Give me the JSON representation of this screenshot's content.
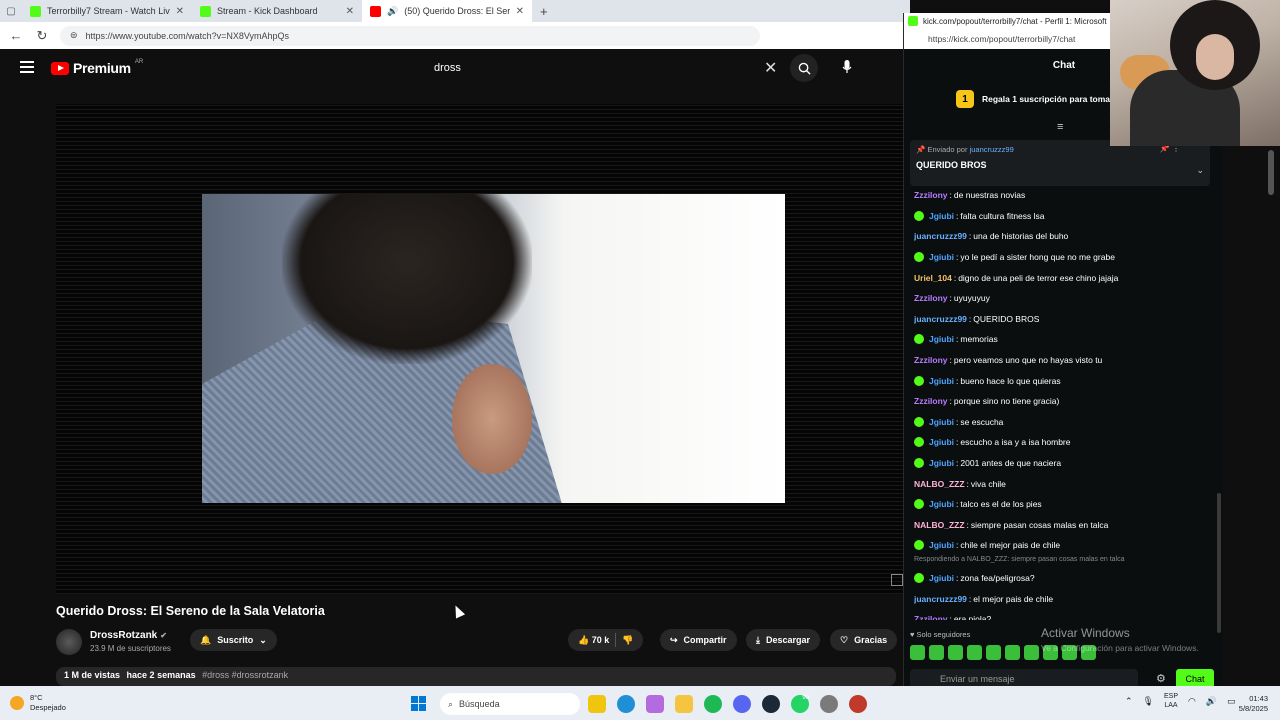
{
  "browser": {
    "tabs": [
      {
        "title": "Terrorbilly7 Stream - Watch Live o",
        "color": "#53fc18"
      },
      {
        "title": "Stream - Kick Dashboard",
        "color": "#53fc18"
      },
      {
        "title": "(50) Querido Dross: El Sereno",
        "color": "#ff0000"
      }
    ],
    "url": "https://www.youtube.com/watch?v=NX8VymAhpQs"
  },
  "youtube": {
    "logo": "Premium",
    "country": "AR",
    "search_value": "dross",
    "video_title": "Querido Dross: El Sereno de la Sala Velatoria",
    "channel_name": "DrossRotzank",
    "verified_mark": "✔",
    "subscribers": "23.9 M de suscriptores",
    "subscribed_label": "Suscrito",
    "likes": "70 k",
    "share_label": "Compartir",
    "download_label": "Descargar",
    "thanks_label": "Gracias",
    "views": "1 M de vistas",
    "age": "hace 2 semanas",
    "tags": "#dross #drossrotzank"
  },
  "kick": {
    "window_title": "kick.com/popout/terrorbilly7/chat - Perfil 1: Microsoft",
    "url": "https://kick.com/popout/terrorbilly7/chat",
    "header": "Chat",
    "gift_count": "1",
    "gift_text": "Regala 1 suscripción para toma",
    "pinned_prefix": "Enviado por",
    "pinned_user": "juancruzzz99",
    "pinned_message": "QUERIDO BROS",
    "reply_note": "Respondiendo a NALBO_ZZZ: siempre pasan cosas malas en talca",
    "messages_a": [
      {
        "user": "Zzzilony",
        "text": "de nuestras novias",
        "color": "#b67cff",
        "badge": false
      },
      {
        "user": "Jgiubi",
        "text": "falta cultura fitness lsa",
        "color": "#4fa3ff",
        "badge": true
      },
      {
        "user": "juancruzzz99",
        "text": "una de historias del buho",
        "color": "#6ab0ff",
        "badge": false
      },
      {
        "user": "Jgiubi",
        "text": "yo le pedí a sister hong que no me grabe",
        "color": "#4fa3ff",
        "badge": true
      },
      {
        "user": "Uriel_104",
        "text": "digno de una peli de terror ese chino jajaja",
        "color": "#f5c16c",
        "badge": false
      },
      {
        "user": "Zzzilony",
        "text": "uyuyuyuy",
        "color": "#b67cff",
        "badge": false
      },
      {
        "user": "juancruzzz99",
        "text": "QUERIDO BROS",
        "color": "#6ab0ff",
        "badge": false
      },
      {
        "user": "Jgiubi",
        "text": "memorias",
        "color": "#4fa3ff",
        "badge": true
      },
      {
        "user": "Zzzilony",
        "text": "pero veamos uno que no hayas visto tu",
        "color": "#b67cff",
        "badge": false
      },
      {
        "user": "Jgiubi",
        "text": "bueno hace lo que quieras",
        "color": "#4fa3ff",
        "badge": true
      },
      {
        "user": "Zzzilony",
        "text": "porque sino no tiene gracia)",
        "color": "#b67cff",
        "badge": false
      },
      {
        "user": "Jgiubi",
        "text": "se escucha",
        "color": "#4fa3ff",
        "badge": true
      },
      {
        "user": "Jgiubi",
        "text": "escucho a isa y a isa hombre",
        "color": "#4fa3ff",
        "badge": true
      },
      {
        "user": "Jgiubi",
        "text": "2001 antes de que naciera",
        "color": "#4fa3ff",
        "badge": true
      },
      {
        "user": "NALBO_ZZZ",
        "text": "viva chile",
        "color": "#ffb3d9",
        "badge": false
      },
      {
        "user": "Jgiubi",
        "text": "talco es el de los pies",
        "color": "#4fa3ff",
        "badge": true
      },
      {
        "user": "NALBO_ZZZ",
        "text": "siempre pasan cosas malas en talca",
        "color": "#ffb3d9",
        "badge": false
      },
      {
        "user": "Jgiubi",
        "text": "chile el mejor pais de chile",
        "color": "#4fa3ff",
        "badge": true
      }
    ],
    "messages_b": [
      {
        "user": "Jgiubi",
        "text": "zona fea/peligrosa?",
        "color": "#4fa3ff",
        "badge": true
      },
      {
        "user": "juancruzzz99",
        "text": "el mejor pais de chile",
        "color": "#6ab0ff",
        "badge": false
      },
      {
        "user": "Zzzilony",
        "text": "era piola?",
        "color": "#b67cff",
        "badge": false
      }
    ],
    "followers_only": "Solo seguidores",
    "input_placeholder": "Enviar un mensaje",
    "send_label": "Chat",
    "accent": "#53fc18"
  },
  "watermark": {
    "line1": "Activar Windows",
    "line2": "Ve a Configuración para activar Windows."
  },
  "taskbar": {
    "temp": "8°C",
    "weather": "Despejado",
    "search": "Búsqueda",
    "lang1": "ESP",
    "lang2": "LAA",
    "time": "01:43",
    "date": "5/8/2025",
    "notif": "90"
  }
}
